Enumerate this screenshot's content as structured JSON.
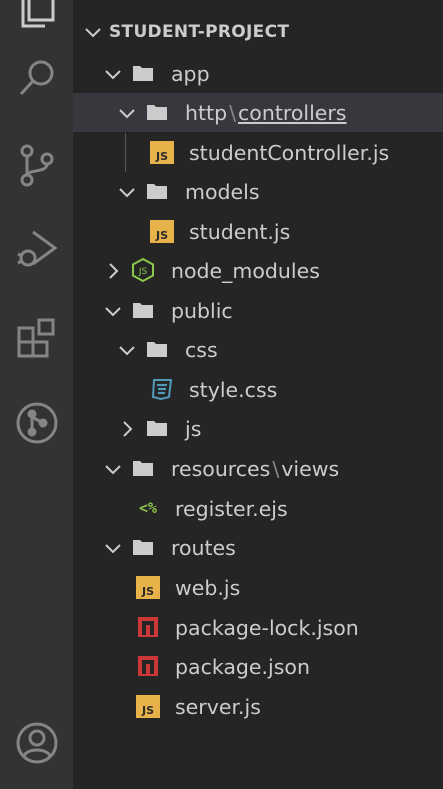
{
  "colors": {
    "activitybar_bg": "#333333",
    "sidebar_bg": "#252526",
    "selected_row": "#37373d",
    "text": "#cccccc",
    "icon": "#858585",
    "js_yellow": "#e7b24a",
    "npm_red": "#cb3837",
    "css_blue": "#519aba",
    "ejs_green": "#8dc149",
    "node_green": "#8cc84b"
  },
  "activitybar": {
    "items": [
      {
        "name": "explorer-icon"
      },
      {
        "name": "search-icon"
      },
      {
        "name": "source-control-icon"
      },
      {
        "name": "run-debug-icon"
      },
      {
        "name": "extensions-icon"
      },
      {
        "name": "git-graph-icon"
      },
      {
        "name": "accounts-icon"
      }
    ]
  },
  "explorer": {
    "section_title": "STUDENT-PROJECT",
    "items": [
      {
        "label": "app",
        "type": "folder",
        "expanded": true
      },
      {
        "label": "http",
        "label2": "controllers",
        "type": "folder",
        "expanded": true,
        "selected": true
      },
      {
        "label": "studentController.js",
        "type": "js",
        "js_badge": "JS"
      },
      {
        "label": "models",
        "type": "folder",
        "expanded": true
      },
      {
        "label": "student.js",
        "type": "js",
        "js_badge": "JS"
      },
      {
        "label": "node_modules",
        "type": "node",
        "expanded": false
      },
      {
        "label": "public",
        "type": "folder",
        "expanded": true
      },
      {
        "label": "css",
        "type": "folder",
        "expanded": true
      },
      {
        "label": "style.css",
        "type": "css"
      },
      {
        "label": "js",
        "type": "folder",
        "expanded": false
      },
      {
        "label": "resources",
        "label2": "views",
        "type": "folder",
        "expanded": true
      },
      {
        "label": "register.ejs",
        "type": "ejs",
        "ejs_glyph": "<%"
      },
      {
        "label": "routes",
        "type": "folder",
        "expanded": true
      },
      {
        "label": "web.js",
        "type": "js",
        "js_badge": "JS"
      },
      {
        "label": "package-lock.json",
        "type": "npm"
      },
      {
        "label": "package.json",
        "type": "npm"
      },
      {
        "label": "server.js",
        "type": "js",
        "js_badge": "JS"
      }
    ]
  }
}
